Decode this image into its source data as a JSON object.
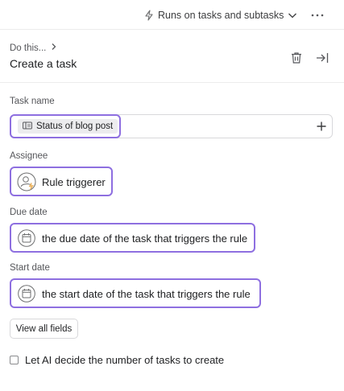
{
  "topbar": {
    "runs_on_label": "Runs on tasks and subtasks",
    "icons": {
      "runs_on": "lightning-icon",
      "chevron": "chevron-down-icon",
      "more": "more-horizontal-icon"
    }
  },
  "header": {
    "breadcrumb": "Do this...",
    "title": "Create a task",
    "icons": {
      "breadcrumb": "chevron-right-icon",
      "delete": "trash-icon",
      "collapse": "collapse-panel-icon"
    }
  },
  "task_name": {
    "label": "Task name",
    "chip_text": "Status of blog post",
    "chip_icon": "field-token-icon",
    "add_icon": "plus-icon"
  },
  "assignee": {
    "label": "Assignee",
    "value": "Rule triggerer",
    "icon": "user-lightning-icon"
  },
  "due_date": {
    "label": "Due date",
    "value": "the due date of the task that triggers the rule",
    "icon": "calendar-icon"
  },
  "start_date": {
    "label": "Start date",
    "value": "the start date of the task that triggers the rule",
    "icon": "calendar-icon"
  },
  "view_all_label": "View all fields",
  "ai_option": {
    "label": "Let AI decide the number of tasks to create",
    "checked": false
  },
  "colors": {
    "accent_border": "#8e6fe0",
    "lightning": "#f1bd6c",
    "divider": "#ececec"
  }
}
